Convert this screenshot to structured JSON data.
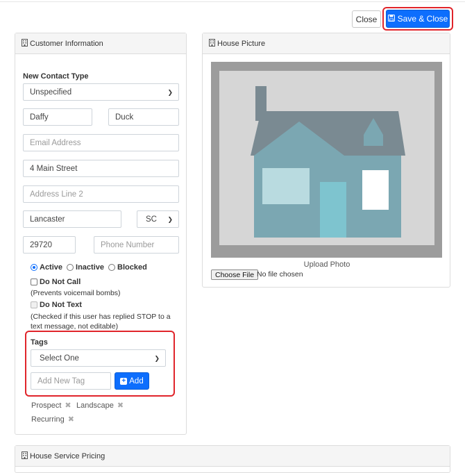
{
  "toolbar": {
    "close_label": "Close",
    "save_close_label": "Save & Close"
  },
  "customer": {
    "header": "Customer Information",
    "contact_type_label": "New Contact Type",
    "contact_type_value": "Unspecified",
    "first_name": "Daffy",
    "last_name": "Duck",
    "email_placeholder": "Email Address",
    "address1": "4 Main Street",
    "address2_placeholder": "Address Line 2",
    "city": "Lancaster",
    "state": "SC",
    "zip": "29720",
    "phone_placeholder": "Phone Number",
    "status_options": [
      "Active",
      "Inactive",
      "Blocked"
    ],
    "status_selected": "Active",
    "do_not_call_label": "Do Not Call",
    "do_not_call_note": "(Prevents voicemail bombs)",
    "do_not_text_label": "Do Not Text",
    "do_not_text_note_1": "(Checked if this user has replied STOP to a",
    "do_not_text_note_2": "text message, not editable)",
    "tags_label": "Tags",
    "tags_select_value": "Select One",
    "new_tag_placeholder": "Add New Tag",
    "add_label": "Add",
    "tags": [
      "Prospect",
      "Landscape",
      "Recurring"
    ]
  },
  "house": {
    "header": "House Picture",
    "upload_caption": "Upload Photo",
    "choose_file_label": "Choose File",
    "file_status": "No file chosen"
  },
  "pricing": {
    "header": "House Service Pricing"
  },
  "colors": {
    "primary": "#0d6efd",
    "highlight": "#e0242a",
    "roof": "#7a8a92",
    "house_body": "#7ba7b2",
    "door": "#7ec4cf"
  }
}
